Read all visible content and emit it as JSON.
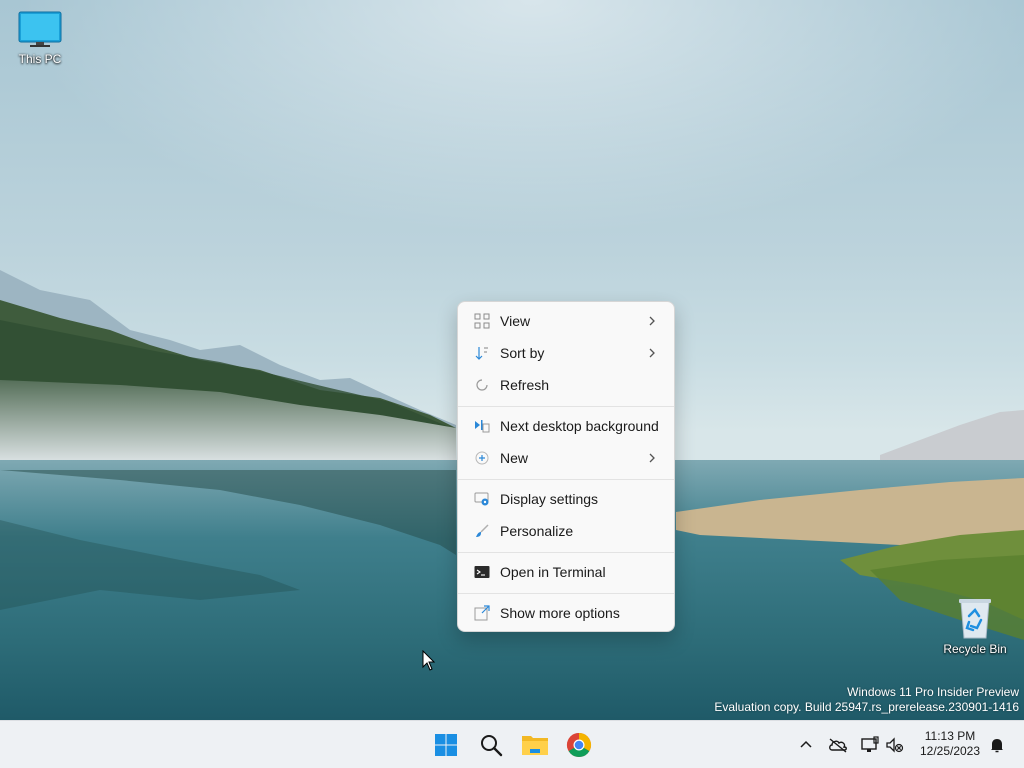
{
  "desktop": {
    "icons": [
      {
        "label": "This PC",
        "icon": "monitor-icon"
      },
      {
        "label": "Recycle Bin",
        "icon": "recycle-bin-icon"
      }
    ],
    "watermark": {
      "line1": "Windows 11 Pro Insider Preview",
      "line2": "Evaluation copy. Build 25947.rs_prerelease.230901-1416"
    }
  },
  "context_menu": {
    "items": [
      {
        "label": "View",
        "icon": "view-grid-icon",
        "submenu": true
      },
      {
        "label": "Sort by",
        "icon": "sort-icon",
        "submenu": true
      },
      {
        "label": "Refresh",
        "icon": "refresh-icon",
        "submenu": false
      },
      {
        "label": "Next desktop background",
        "icon": "next-background-icon",
        "submenu": false
      },
      {
        "label": "New",
        "icon": "new-plus-icon",
        "submenu": true
      },
      {
        "label": "Display settings",
        "icon": "display-settings-icon",
        "submenu": false
      },
      {
        "label": "Personalize",
        "icon": "personalize-brush-icon",
        "submenu": false
      },
      {
        "label": "Open in Terminal",
        "icon": "terminal-icon",
        "submenu": false
      },
      {
        "label": "Show more options",
        "icon": "more-options-icon",
        "submenu": false
      }
    ]
  },
  "taskbar": {
    "pinned": [
      {
        "name": "Start",
        "icon": "windows-start-icon"
      },
      {
        "name": "Search",
        "icon": "search-icon"
      },
      {
        "name": "File Explorer",
        "icon": "file-explorer-icon"
      },
      {
        "name": "Google Chrome",
        "icon": "chrome-icon"
      }
    ],
    "tray": {
      "icons": [
        "chevron-up-icon",
        "onedrive-offline-icon",
        "network-icon",
        "volume-muted-icon",
        "notification-bell-icon"
      ],
      "time": "11:13 PM",
      "date": "12/25/2023"
    }
  },
  "colors": {
    "accent": "#0078d4",
    "menu_bg": "#f9f9f9",
    "taskbar_bg": "#eef1f4"
  }
}
